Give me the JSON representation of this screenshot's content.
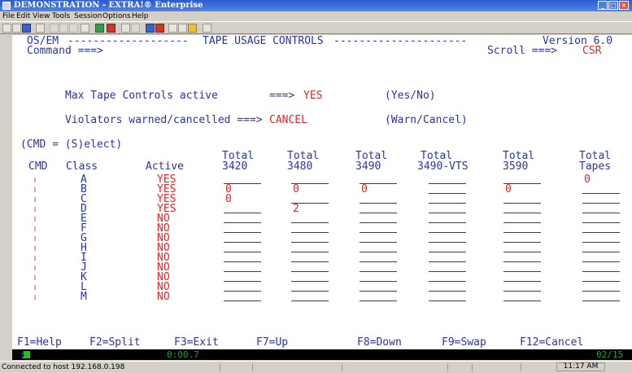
{
  "window": {
    "title": "DEMONSTRATION - EXTRA!® Enterprise",
    "buttons": [
      "_",
      "□",
      "×"
    ]
  },
  "menu": [
    "File",
    "Edit",
    "View",
    "Tools",
    "Session",
    "Options",
    "Help"
  ],
  "toolbar_icons": [
    "new-session",
    "open",
    "save",
    "print",
    "cut",
    "copy",
    "paste",
    "send",
    "macro",
    "send-receive",
    "transfer",
    "record-macro",
    "play",
    "connect",
    "disconnect",
    "quickpad",
    "properties",
    "help"
  ],
  "screen": {
    "header_left": "OS/EM",
    "header_title": "TAPE USAGE CONTROLS",
    "version": "Version 6.0",
    "command_label": "Command ===>",
    "scroll_label": "Scroll ===>",
    "scroll_value": "CSR",
    "opt1_label": "Max Tape Controls active",
    "opt1_arrow": "===>",
    "opt1_value": "YES",
    "opt1_hint": "(Yes/No)",
    "opt2_label": "Violators warned/cancelled ===>",
    "opt2_value": "CANCEL",
    "opt2_hint": "(Warn/Cancel)",
    "cmd_hint": "(CMD = (S)elect)",
    "col_total": "Total",
    "columns": [
      "CMD",
      "Class",
      "Active",
      "3420",
      "3480",
      "3490",
      "3490-VTS",
      "3590",
      "Tapes"
    ],
    "rows": [
      {
        "class": "A",
        "active": "YES",
        "c3420": "",
        "c3480": "",
        "c3490": "",
        "vts": "",
        "c3590": "",
        "tapes": "0"
      },
      {
        "class": "B",
        "active": "YES",
        "c3420": "0",
        "c3480": "0",
        "c3490": "0",
        "vts": "",
        "c3590": "0",
        "tapes": ""
      },
      {
        "class": "C",
        "active": "YES",
        "c3420": "0",
        "c3480": "",
        "c3490": "",
        "vts": "",
        "c3590": "",
        "tapes": ""
      },
      {
        "class": "D",
        "active": "YES",
        "c3420": "",
        "c3480": "2",
        "c3490": "",
        "vts": "",
        "c3590": "",
        "tapes": ""
      },
      {
        "class": "E",
        "active": "NO",
        "c3420": "",
        "c3480": "",
        "c3490": "",
        "vts": "",
        "c3590": "",
        "tapes": ""
      },
      {
        "class": "F",
        "active": "NO",
        "c3420": "",
        "c3480": "",
        "c3490": "",
        "vts": "",
        "c3590": "",
        "tapes": ""
      },
      {
        "class": "G",
        "active": "NO",
        "c3420": "",
        "c3480": "",
        "c3490": "",
        "vts": "",
        "c3590": "",
        "tapes": ""
      },
      {
        "class": "H",
        "active": "NO",
        "c3420": "",
        "c3480": "",
        "c3490": "",
        "vts": "",
        "c3590": "",
        "tapes": ""
      },
      {
        "class": "I",
        "active": "NO",
        "c3420": "",
        "c3480": "",
        "c3490": "",
        "vts": "",
        "c3590": "",
        "tapes": ""
      },
      {
        "class": "J",
        "active": "NO",
        "c3420": "",
        "c3480": "",
        "c3490": "",
        "vts": "",
        "c3590": "",
        "tapes": ""
      },
      {
        "class": "K",
        "active": "NO",
        "c3420": "",
        "c3480": "",
        "c3490": "",
        "vts": "",
        "c3590": "",
        "tapes": ""
      },
      {
        "class": "L",
        "active": "NO",
        "c3420": "",
        "c3480": "",
        "c3490": "",
        "vts": "",
        "c3590": "",
        "tapes": ""
      },
      {
        "class": "M",
        "active": "NO",
        "c3420": "",
        "c3480": "",
        "c3490": "",
        "vts": "",
        "c3590": "",
        "tapes": ""
      }
    ],
    "pf_keys": [
      "F1=Help",
      "F2=Split",
      "F3=Exit",
      "F7=Up",
      "F8=Down",
      "F9=Swap",
      "F12=Cancel"
    ]
  },
  "oia": {
    "session_id": "04",
    "timer": "0:00.7",
    "cursor_pos": "02/15"
  },
  "statusbar": {
    "connection": "Connected to host 192.168.0.198",
    "clock": "11:17 AM"
  },
  "colors": {
    "title_bar": "#3a6fd8",
    "terminal_bg": "#ffffff",
    "terminal_text": "#2a33a8",
    "terminal_red": "#e3242b",
    "oia_bg": "#000000"
  }
}
